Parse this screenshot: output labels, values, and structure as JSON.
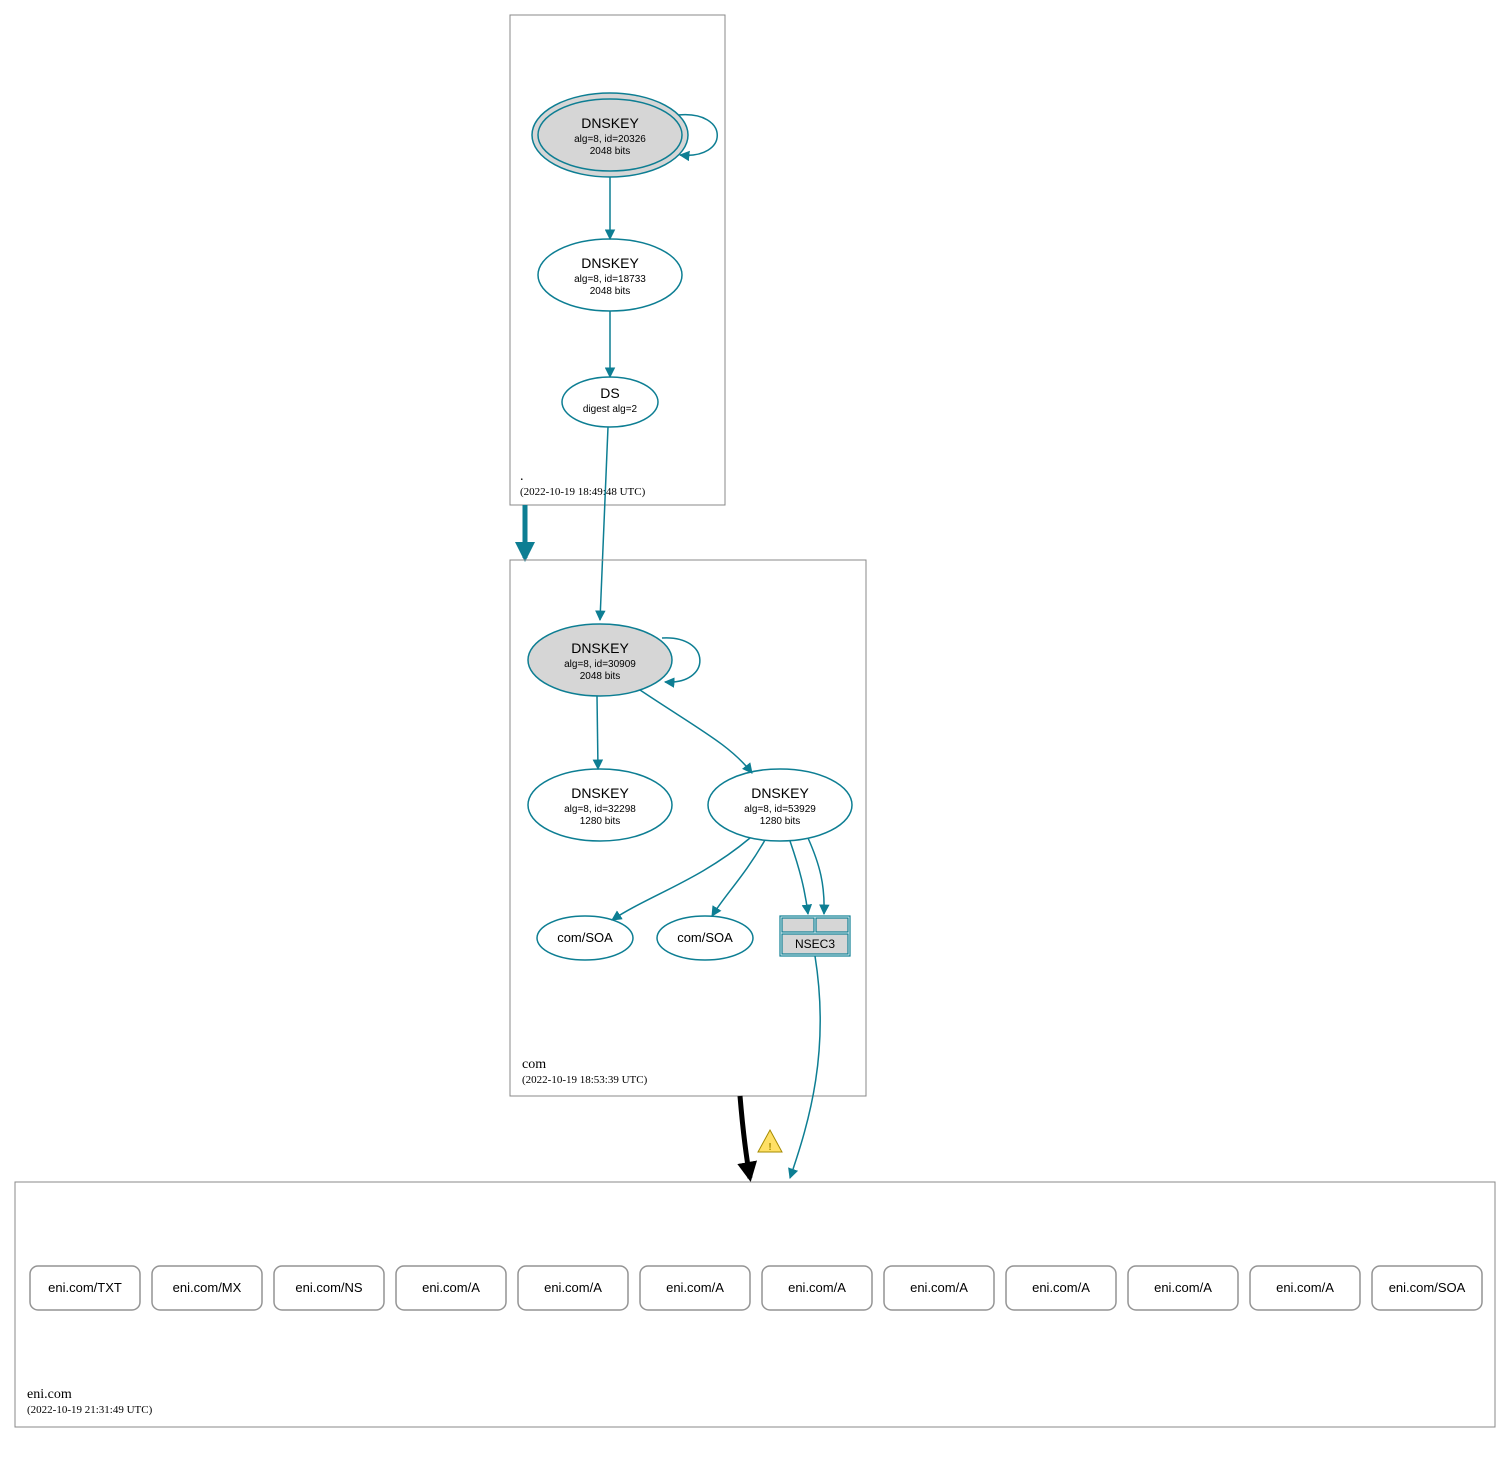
{
  "zones": {
    "root": {
      "label": ".",
      "timestamp": "(2022-10-19 18:49:48 UTC)"
    },
    "com": {
      "label": "com",
      "timestamp": "(2022-10-19 18:53:39 UTC)"
    },
    "eni": {
      "label": "eni.com",
      "timestamp": "(2022-10-19 21:31:49 UTC)"
    }
  },
  "nodes": {
    "root_ksk": {
      "title": "DNSKEY",
      "line1": "alg=8, id=20326",
      "line2": "2048 bits"
    },
    "root_zsk": {
      "title": "DNSKEY",
      "line1": "alg=8, id=18733",
      "line2": "2048 bits"
    },
    "root_ds": {
      "title": "DS",
      "line1": "digest alg=2"
    },
    "com_ksk": {
      "title": "DNSKEY",
      "line1": "alg=8, id=30909",
      "line2": "2048 bits"
    },
    "com_zsk1": {
      "title": "DNSKEY",
      "line1": "alg=8, id=32298",
      "line2": "1280 bits"
    },
    "com_zsk2": {
      "title": "DNSKEY",
      "line1": "alg=8, id=53929",
      "line2": "1280 bits"
    },
    "com_soa1": {
      "label": "com/SOA"
    },
    "com_soa2": {
      "label": "com/SOA"
    },
    "nsec3": {
      "label": "NSEC3"
    }
  },
  "eni_records": [
    "eni.com/TXT",
    "eni.com/MX",
    "eni.com/NS",
    "eni.com/A",
    "eni.com/A",
    "eni.com/A",
    "eni.com/A",
    "eni.com/A",
    "eni.com/A",
    "eni.com/A",
    "eni.com/A",
    "eni.com/SOA"
  ]
}
